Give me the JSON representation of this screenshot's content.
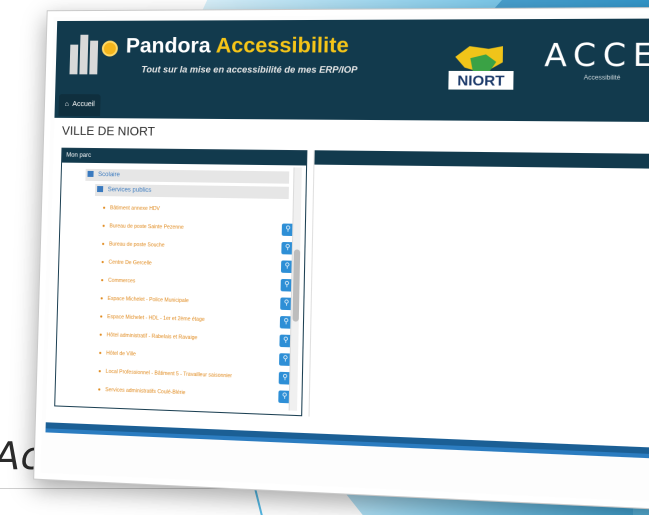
{
  "slide": {
    "caption": "Accueil",
    "colors": {
      "accent_blue": "#2e8fd6",
      "header_dark": "#123a4d",
      "link_orange": "#e08a1e"
    }
  },
  "app": {
    "title_main": "Pandora",
    "title_accent": "Accessibilite",
    "subtitle": "Tout sur la mise en accessibilité de mes ERP/IOP",
    "partner_logo_text": "NIORT",
    "brand_logo_text": "ACCEO",
    "brand_logo_sub": "Accessibilité",
    "home_tab": "Accueil"
  },
  "page": {
    "heading": "VILLE DE NIORT",
    "panel_title": "Mon parc",
    "tree": [
      {
        "label": "Scolaire",
        "level": 0
      },
      {
        "label": "Services publics",
        "level": 1
      }
    ],
    "items": [
      "Bâtiment annexe HDV",
      "Bureau de poste Sainte Pezenne",
      "Bureau de poste Souche",
      "Centre De Gercelle",
      "Commerces",
      "Espace Michelet - Police Municipale",
      "Espace Michelet - HDL - 1er et 2ème étage",
      "Hôtel administratif - Rabelais et Ravaige",
      "Hôtel de Ville",
      "Local Professionnel - Bâtiment 5 - Travailleur saisonnier",
      "Services administratifs Coulé-Blérie"
    ],
    "item_button_icon": "search-icon"
  }
}
